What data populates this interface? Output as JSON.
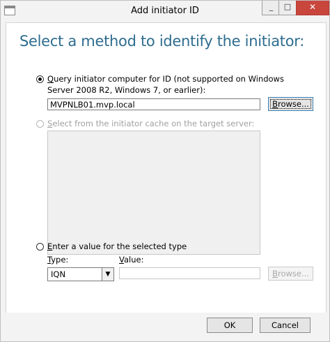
{
  "window": {
    "title": "Add initiator ID",
    "minimize_glyph": "_",
    "maximize_glyph": "□",
    "close_glyph": "✕"
  },
  "heading": "Select a method to identify the initiator:",
  "option_query": {
    "label_underlined": "Q",
    "label_rest_line1": "uery initiator computer for ID (not supported on Windows",
    "label_line2": "Server 2008 R2, Windows 7, or earlier):",
    "selected": true,
    "computer_value": "MVPNLB01.mvp.local",
    "browse_underlined": "B",
    "browse_rest": "rowse..."
  },
  "option_cache": {
    "label_underlined": "S",
    "label_rest": "elect from the initiator cache on the target server:",
    "selected": false,
    "enabled": false
  },
  "option_enter": {
    "label_underlined": "E",
    "label_rest": "nter a value for the selected type",
    "selected": false,
    "type_label_underlined": "T",
    "type_label_rest": "ype:",
    "type_value": "IQN",
    "value_label_underlined": "V",
    "value_label_rest": "alue:",
    "value_value": "",
    "browse_underlined": "B",
    "browse_rest": "rowse..."
  },
  "footer": {
    "ok_label": "OK",
    "cancel_label": "Cancel"
  }
}
